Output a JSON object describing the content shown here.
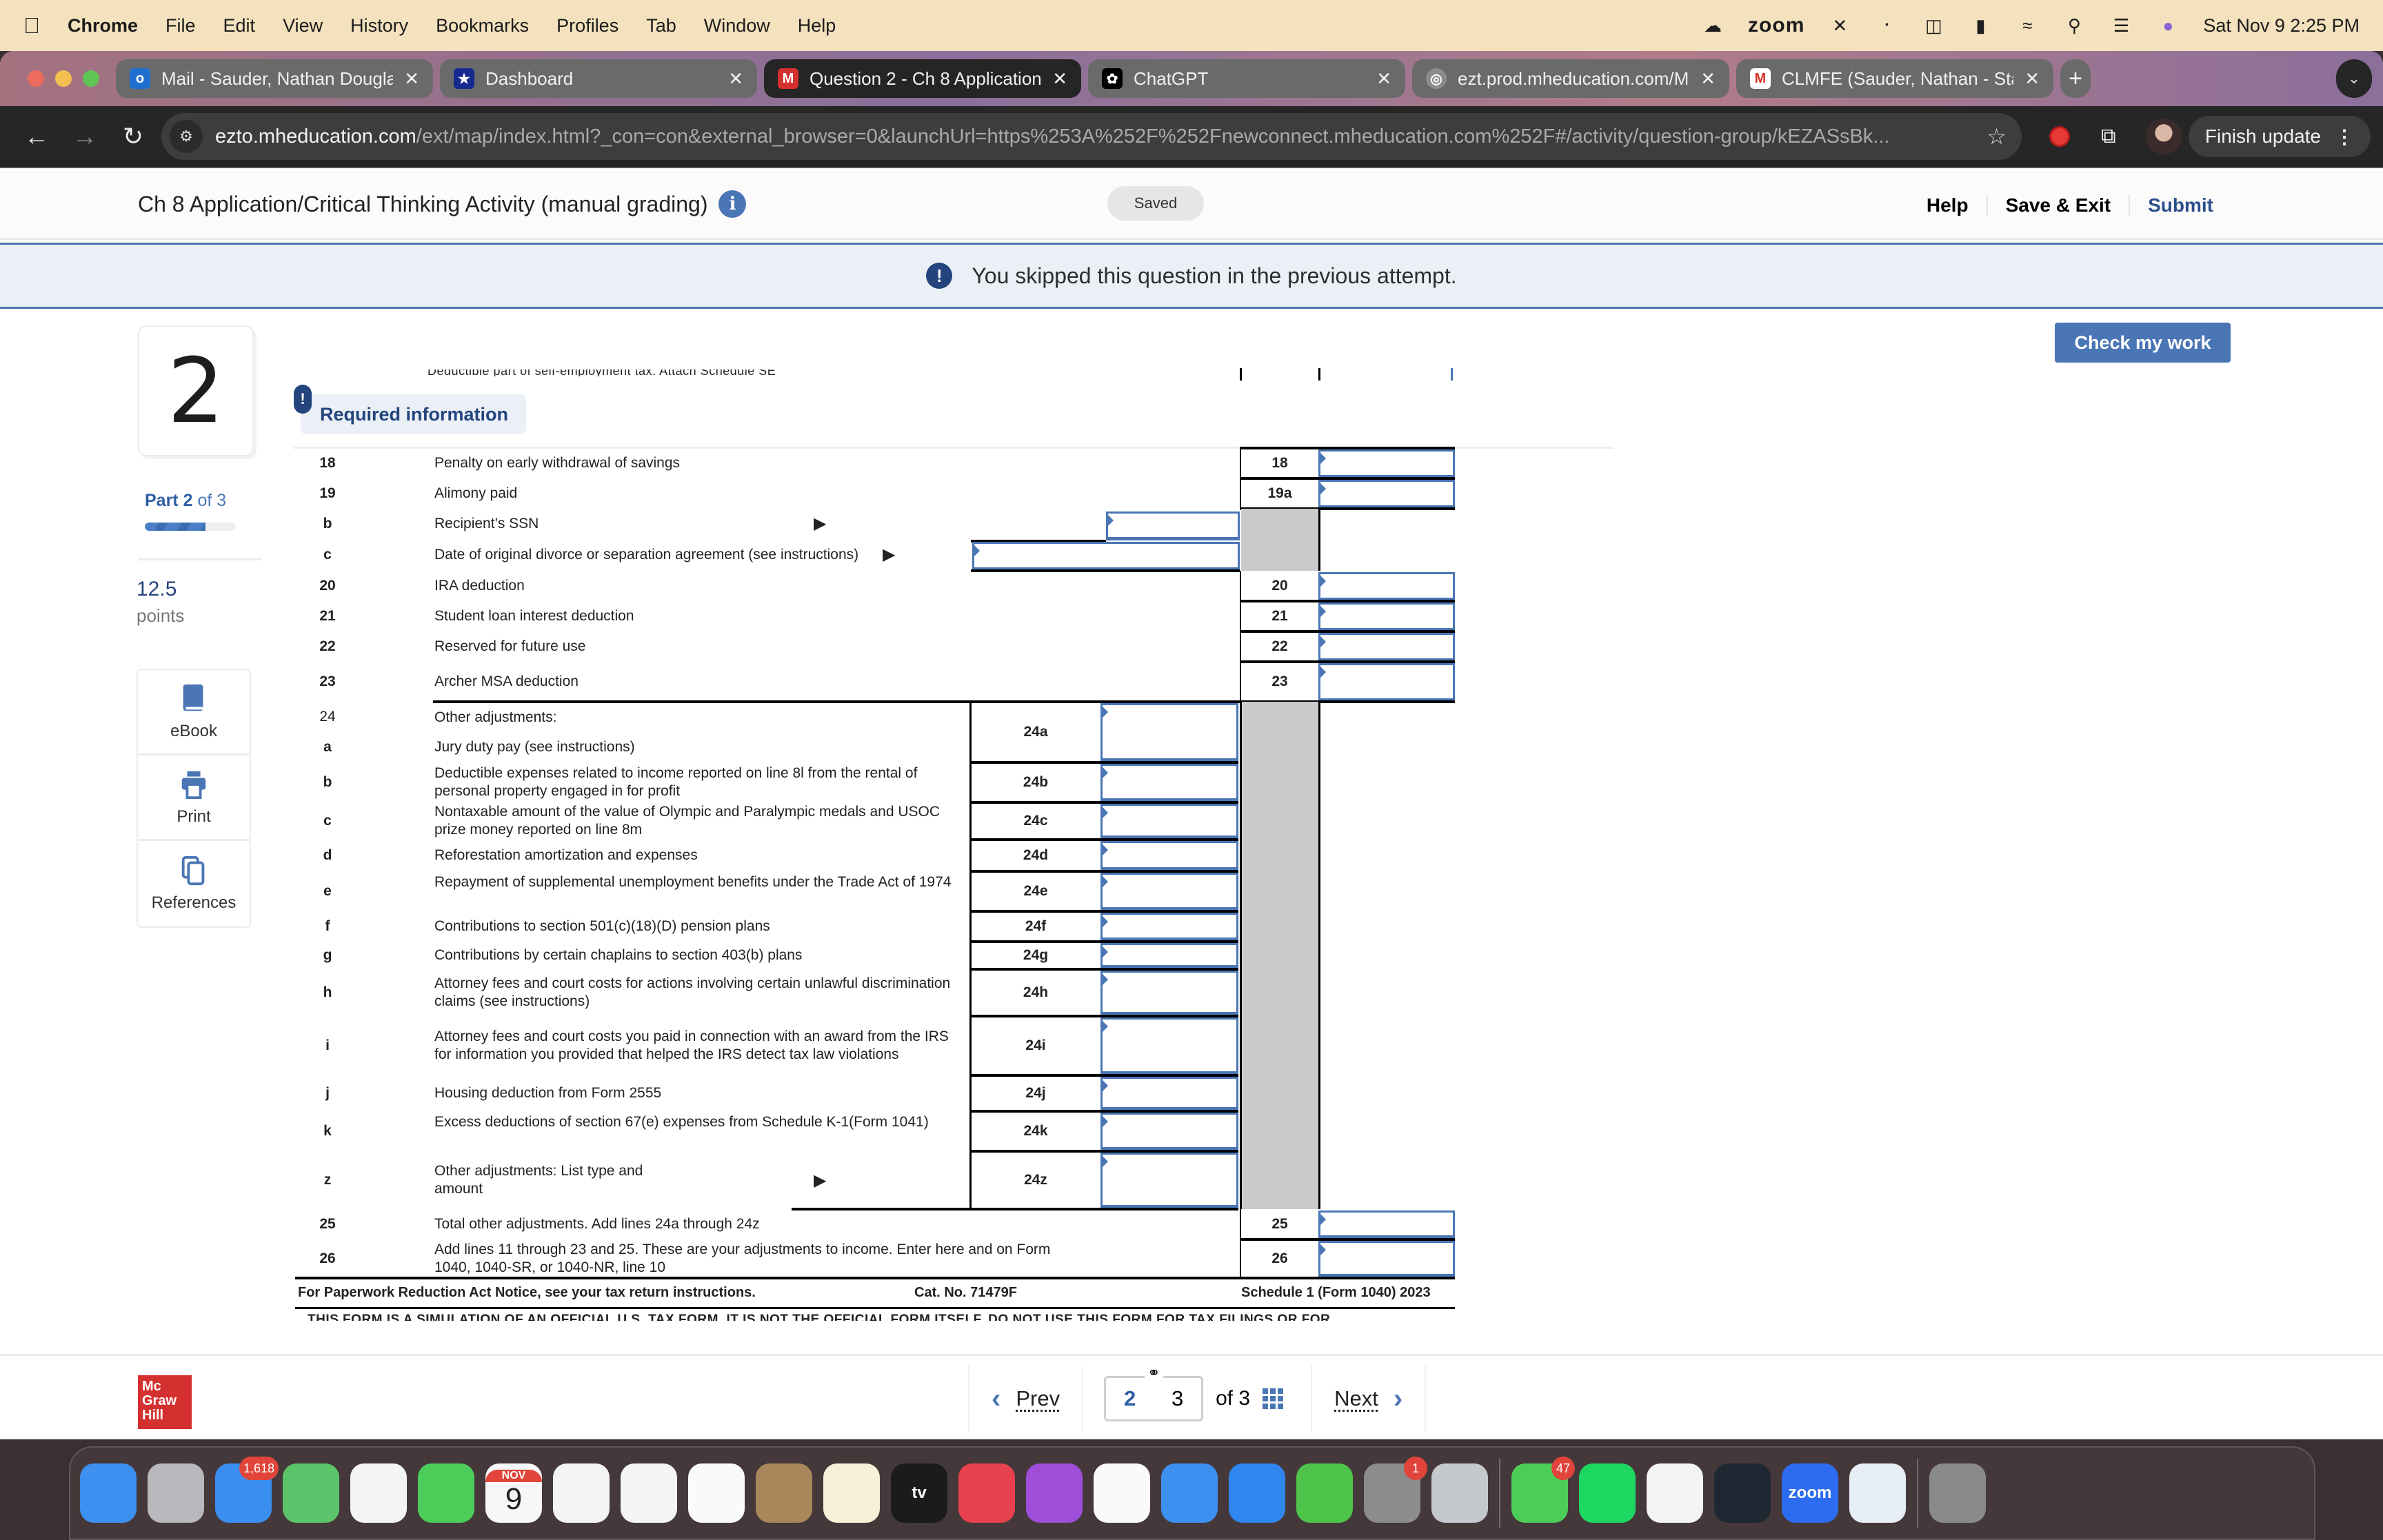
{
  "menubar": {
    "app_name": "Chrome",
    "items": [
      "File",
      "Edit",
      "View",
      "History",
      "Bookmarks",
      "Profiles",
      "Tab",
      "Window",
      "Help"
    ],
    "zoom_label": "zoom",
    "datetime": "Sat Nov 9  2:25 PM"
  },
  "browser": {
    "tabs": [
      {
        "title": "Mail - Sauder, Nathan Dougla",
        "icon": "outlook-icon",
        "active": false
      },
      {
        "title": "Dashboard",
        "icon": "dashboard-star-icon",
        "active": false
      },
      {
        "title": "Question 2 - Ch 8 Application",
        "icon": "mcgraw-m-icon",
        "active": true
      },
      {
        "title": "ChatGPT",
        "icon": "chatgpt-icon",
        "active": false
      },
      {
        "title": "ezt.prod.mheducation.com/M",
        "icon": "globe-icon",
        "active": false
      },
      {
        "title": "CLMFE (Sauder, Nathan - Sta",
        "icon": "gmail-icon",
        "active": false
      }
    ],
    "url_host": "ezto.mheducation.com",
    "url_path": "/ext/map/index.html?_con=con&external_browser=0&launchUrl=https%253A%252F%252Fnewconnect.mheducation.com%252F#/activity/question-group/kEZASsBk...",
    "finish_update_label": "Finish update"
  },
  "header": {
    "title": "Ch 8 Application/Critical Thinking Activity (manual grading)",
    "saved_label": "Saved",
    "help_label": "Help",
    "save_exit_label": "Save & Exit",
    "submit_label": "Submit"
  },
  "notice": {
    "text": "You skipped this question in the previous attempt."
  },
  "check_work_label": "Check my work",
  "question": {
    "number": "2",
    "part_current": "Part 2",
    "part_total": "of 3",
    "part_progress": 0.667,
    "points_value": "12.5",
    "points_label": "points",
    "tools": [
      "eBook",
      "Print",
      "References"
    ],
    "required_info_label": "Required information",
    "cut_off_text": "Deductible part of self-employment tax. Attach Schedule SE"
  },
  "form": {
    "rows": [
      {
        "line": "18",
        "desc": "Penalty on early withdrawal of savings",
        "box": "18"
      },
      {
        "line": "19",
        "desc": "Alimony paid",
        "box": "19a"
      },
      {
        "line": "b",
        "desc": "Recipient’s SSN"
      },
      {
        "line": "c",
        "desc": "Date of original divorce or separation agreement (see instructions)"
      },
      {
        "line": "20",
        "desc": "IRA deduction",
        "box": "20"
      },
      {
        "line": "21",
        "desc": "Student loan interest deduction",
        "box": "21"
      },
      {
        "line": "22",
        "desc": "Reserved for future use",
        "box": "22"
      },
      {
        "line": "23",
        "desc": "Archer MSA deduction",
        "box": "23"
      }
    ],
    "other_header": {
      "line": "24",
      "desc": "Other adjustments:"
    },
    "sub_rows": [
      {
        "line": "a",
        "desc": "Jury duty pay (see instructions)",
        "box": "24a"
      },
      {
        "line": "b",
        "desc": "Deductible expenses related to income reported on line 8l from the rental of personal property engaged in for profit",
        "box": "24b"
      },
      {
        "line": "c",
        "desc": "Nontaxable amount of the value of Olympic and Paralympic medals and USOC prize money reported on line 8m",
        "box": "24c"
      },
      {
        "line": "d",
        "desc": "Reforestation amortization and expenses",
        "box": "24d"
      },
      {
        "line": "e",
        "desc": "Repayment of supplemental unemployment benefits under the Trade Act of 1974",
        "box": "24e"
      },
      {
        "line": "f",
        "desc": "Contributions to section 501(c)(18)(D) pension plans",
        "box": "24f"
      },
      {
        "line": "g",
        "desc": "Contributions by certain chaplains to section 403(b) plans",
        "box": "24g"
      },
      {
        "line": "h",
        "desc": "Attorney fees and court costs for actions involving certain unlawful discrimination claims (see instructions)",
        "box": "24h"
      },
      {
        "line": "i",
        "desc": "Attorney fees and court costs you paid in connection with an award from the IRS for information you provided that helped the IRS detect tax law violations",
        "box": "24i"
      },
      {
        "line": "j",
        "desc": "Housing deduction from Form 2555",
        "box": "24j"
      },
      {
        "line": "k",
        "desc": "Excess deductions of section 67(e) expenses from Schedule K-1(Form 1041)",
        "box": "24k"
      },
      {
        "line": "z",
        "desc": "Other adjustments: List type and amount",
        "box": "24z"
      }
    ],
    "totals": [
      {
        "line": "25",
        "desc": "Total other adjustments. Add lines 24a through 24z",
        "box": "25"
      },
      {
        "line": "26",
        "desc": "Add lines 11 through 23 and 25. These are your adjustments to income. Enter here and on Form 1040, 1040-SR, or 1040-NR, line 10",
        "box": "26"
      }
    ],
    "footer_left": "For Paperwork Reduction Act Notice, see your tax return instructions.",
    "footer_center": "Cat. No. 71479F",
    "footer_right": "Schedule 1 (Form 1040) 2023",
    "simulation_notice": "THIS FORM IS A SIMULATION OF AN OFFICIAL U.S. TAX FORM. IT IS NOT THE OFFICIAL FORM ITSELF. DO NOT USE THIS FORM FOR TAX FILINGS OR FOR"
  },
  "pager": {
    "prev_label": "Prev",
    "next_label": "Next",
    "current_page": "2",
    "next_page": "3",
    "of_total": "of 3"
  },
  "logo_text": [
    "Mc",
    "Graw",
    "Hill"
  ],
  "dock": {
    "apps": [
      {
        "name": "Finder",
        "color": "#3d8ff0"
      },
      {
        "name": "Launchpad",
        "color": "#b8b8bd"
      },
      {
        "name": "Mail",
        "color": "#3a8ef0",
        "badge": "1,618"
      },
      {
        "name": "Maps",
        "color": "#5cc46a"
      },
      {
        "name": "Photos",
        "color": "#f4f4f4"
      },
      {
        "name": "FaceTime",
        "color": "#4ccd5a"
      },
      {
        "name": "Calendar",
        "color": "#f7f7f7",
        "month": "NOV",
        "day": "9"
      },
      {
        "name": "Safari",
        "color": "#f4f4f4"
      },
      {
        "name": "Chrome",
        "color": "#f4f4f4"
      },
      {
        "name": "Reminders",
        "color": "#fafafa"
      },
      {
        "name": "Contacts",
        "color": "#a8875a"
      },
      {
        "name": "Notes",
        "color": "#f6f1d8"
      },
      {
        "name": "TV",
        "color": "#1b1b1b",
        "label": "tv"
      },
      {
        "name": "Music",
        "color": "#e8424f"
      },
      {
        "name": "Podcasts",
        "color": "#9e4ed8"
      },
      {
        "name": "News",
        "color": "#fafafa"
      },
      {
        "name": "Keynote",
        "color": "#3d8ff0"
      },
      {
        "name": "App Store",
        "color": "#2f86ee"
      },
      {
        "name": "Numbers",
        "color": "#4fc44a"
      },
      {
        "name": "System Settings",
        "color": "#8c8c8c",
        "badge": "1"
      },
      {
        "name": "Roblox",
        "color": "#c5c8cc"
      },
      {
        "name": "Messages",
        "color": "#4ccd5a",
        "badge": "47"
      },
      {
        "name": "Spotify",
        "color": "#1ed760"
      },
      {
        "name": "Xcode-like X",
        "color": "#f4f4f4"
      },
      {
        "name": "Stocks",
        "color": "#1f2732"
      },
      {
        "name": "Zoom",
        "color": "#2d6cf0",
        "label": "zoom"
      },
      {
        "name": "Preview",
        "color": "#e8eef6"
      },
      {
        "name": "Trash",
        "color": "#8a8a8a"
      }
    ]
  }
}
